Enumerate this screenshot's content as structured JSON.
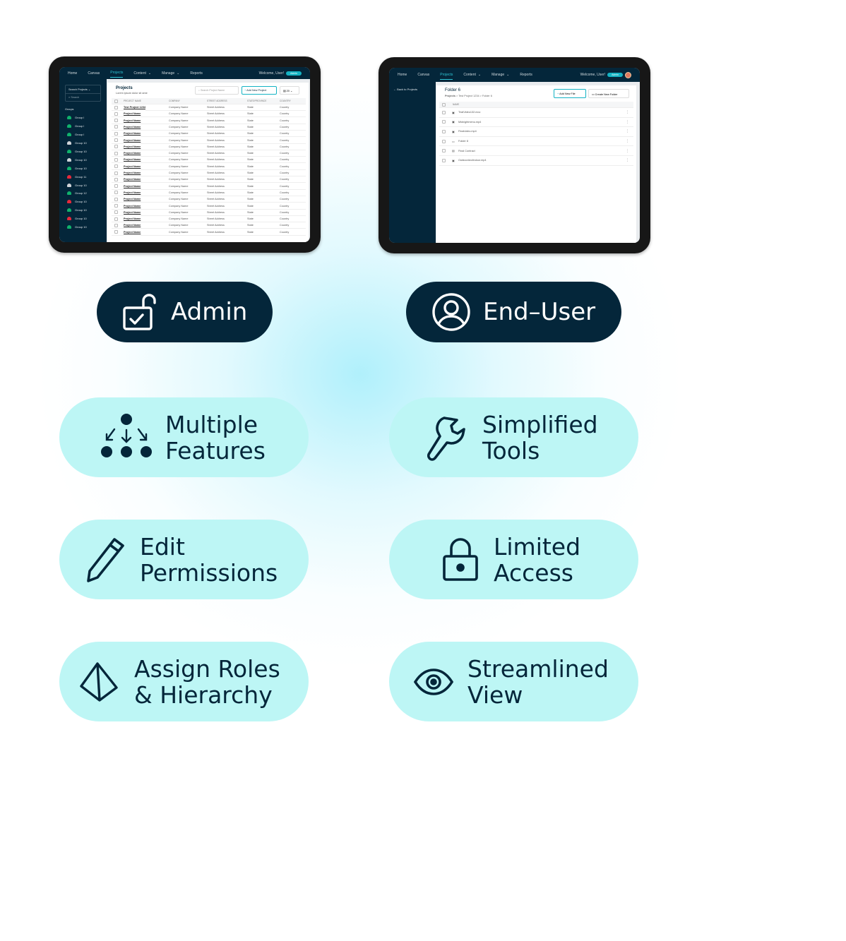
{
  "admin_screen": {
    "nav": [
      "Home",
      "Canvas",
      "Projects",
      "Content",
      "Manage",
      "Reports"
    ],
    "active": "Projects",
    "welcome": "Welcome, User!",
    "badge": "Admin",
    "sidebar": {
      "search_select": "Search Projects",
      "search_placeholder": "Search",
      "groups_label": "Groups",
      "groups": [
        {
          "name": "Group I",
          "color": "#10b26c"
        },
        {
          "name": "Group I",
          "color": "#10b26c"
        },
        {
          "name": "Group I",
          "color": "#10b26c"
        },
        {
          "name": "Group 10",
          "color": "#cfd4d8"
        },
        {
          "name": "Group 10",
          "color": "#10b26c"
        },
        {
          "name": "Group 10",
          "color": "#cfd4d8"
        },
        {
          "name": "Group 10",
          "color": "#10b26c"
        },
        {
          "name": "Group 11",
          "color": "#e5293b"
        },
        {
          "name": "Group 10",
          "color": "#cfd4d8"
        },
        {
          "name": "Group 12",
          "color": "#10b26c"
        },
        {
          "name": "Group 10",
          "color": "#e5293b"
        },
        {
          "name": "Group 10",
          "color": "#10b26c"
        },
        {
          "name": "Group 10",
          "color": "#e5293b"
        },
        {
          "name": "Group 10",
          "color": "#10b26c"
        }
      ]
    },
    "title": "Projects",
    "subtitle": "Lorem ipsum dolor sit ame",
    "search_placeholder": "Search Project Name",
    "add_button": "Add New Project",
    "page_size": "20",
    "columns": [
      "PROJECT NAME",
      "COMPANY",
      "STREET ADDRESS",
      "STATE/PROVINCE",
      "COUNTRY"
    ],
    "first_row": [
      "Test Project 1234",
      "Company Name",
      "Street Address",
      "State",
      "Country"
    ],
    "row": [
      "Project Name",
      "Company Name",
      "Street Address",
      "State",
      "Country"
    ],
    "row_count": 20
  },
  "user_screen": {
    "nav": [
      "Home",
      "Canvas",
      "Projects",
      "Content",
      "Manage",
      "Reports"
    ],
    "active": "Projects",
    "welcome": "Welcome, User!",
    "badge": "Admin",
    "back": "Back to Projects",
    "title": "Folder 6",
    "breadcrumb": [
      "Projects",
      "Test Project 1234",
      "Folder 6"
    ],
    "add_file": "Add New File",
    "create_folder": "Create New Folder",
    "column": "NAME",
    "files": [
      "TrialVideo132.mov",
      "Midnightmenu.mp4",
      "Finalvideo.mp4",
      "Folder 8",
      "Final Contract",
      "OutdoorAndIndoor.mp4"
    ]
  },
  "roles": {
    "admin": "Admin",
    "end_user": "End–User"
  },
  "features": {
    "multiple": [
      "Multiple",
      "Features"
    ],
    "simplified": [
      "Simplified",
      "Tools"
    ],
    "edit": [
      "Edit",
      "Permissions"
    ],
    "limited": [
      "Limited",
      "Access"
    ],
    "assign": [
      "Assign Roles",
      "& Hierarchy"
    ],
    "streamlined": [
      "Streamlined",
      "View"
    ]
  },
  "colors": {
    "dark": "#04263a",
    "light": "#bdf6f5",
    "accent": "#14b3c4"
  }
}
